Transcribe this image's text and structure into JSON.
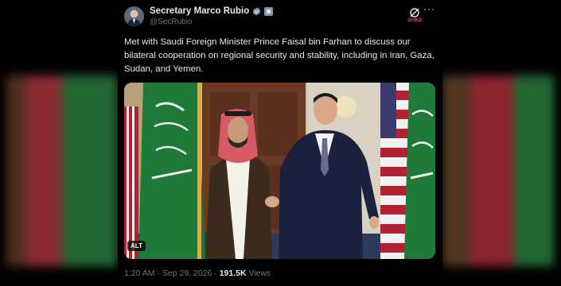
{
  "tweet": {
    "display_name": "Secretary Marco Rubio",
    "handle": "@SecRubio",
    "text": "Met with Saudi Foreign Minister Prince Faisal bin Farhan to discuss our bilateral cooperation on regional security and stability, including in Iran, Gaza, Sudan, and Yemen.",
    "media_alt_label": "ALT",
    "more_label": "···",
    "watermark_label": "anka",
    "time": "1:20 AM",
    "separator": "·",
    "date": "Sep 29, 2026",
    "views_count": "191.5K",
    "views_label": "Views"
  },
  "colors": {
    "background": "#000000",
    "text_primary": "#e7e9ea",
    "text_secondary": "#71767b",
    "verified": "#1d9bf0",
    "saudi_green": "#1f7a3a",
    "us_red": "#b22234",
    "us_blue": "#3c3b6e"
  },
  "icons": [
    "verified-badge-icon",
    "government-badge-icon",
    "grok-icon",
    "more-icon"
  ]
}
